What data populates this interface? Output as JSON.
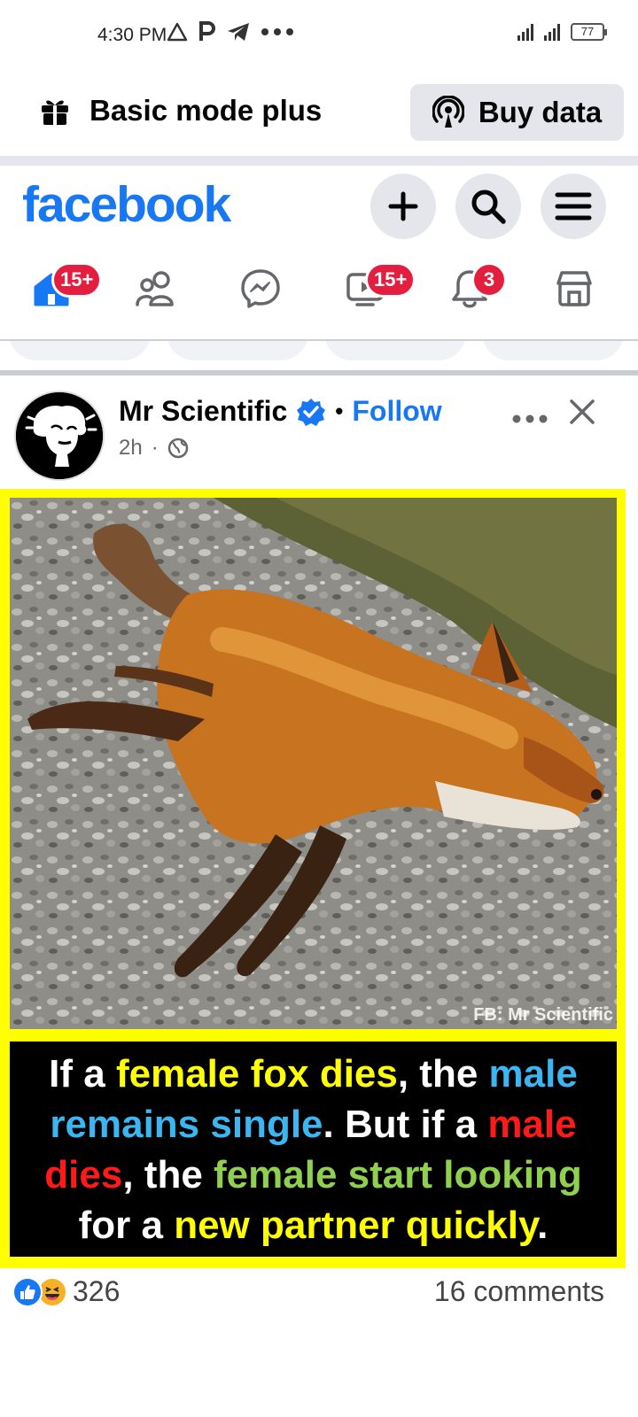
{
  "status_bar": {
    "time": "4:30 PM",
    "left_icons": [
      "warning-triangle-icon",
      "p-app-icon",
      "telegram-icon",
      "more-dots-icon"
    ],
    "battery": "77"
  },
  "mode_bar": {
    "label": "Basic mode plus",
    "buy_label": "Buy data"
  },
  "header": {
    "logo": "facebook"
  },
  "nav": {
    "tabs": [
      {
        "name": "home",
        "badge": "15+"
      },
      {
        "name": "friends",
        "badge": ""
      },
      {
        "name": "messenger",
        "badge": ""
      },
      {
        "name": "video",
        "badge": "15+"
      },
      {
        "name": "notifications",
        "badge": "3"
      },
      {
        "name": "marketplace",
        "badge": ""
      }
    ]
  },
  "post": {
    "author": "Mr Scientific",
    "separator": "•",
    "follow": "Follow",
    "time": "2h",
    "meta_dot": "·",
    "watermark": "FB: Mr Scientific",
    "caption": {
      "line1": [
        "If a ",
        "female fox dies",
        ", the ",
        "male"
      ],
      "line2": [
        "remains single",
        ". But if a ",
        "male"
      ],
      "line3": [
        "dies",
        ", the ",
        "female start looking"
      ],
      "line4": [
        "for a ",
        "new partner quickly",
        "."
      ]
    },
    "reaction_count": "326",
    "comments": "16 comments"
  },
  "colors": {
    "facebook_blue": "#1877f2",
    "badge_red": "#e41e3f",
    "frame_yellow": "#ffff00",
    "caption_yellow": "#ffff00",
    "caption_blue": "#3bb6f0",
    "caption_red": "#ff1a1a",
    "caption_green": "#8fd14f"
  }
}
